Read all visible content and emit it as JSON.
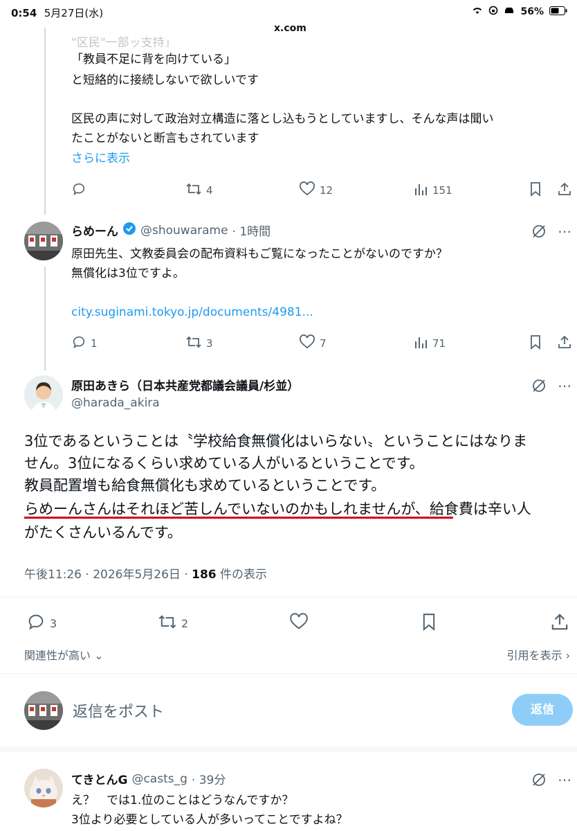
{
  "status_bar": {
    "time": "0:54",
    "date": "5月27日(水)",
    "battery": "56%",
    "url": "x.com"
  },
  "tweet_prev": {
    "partial_line1": "「教員不足に背を向けている」",
    "partial_line2": "と短絡的に接続しないで欲しいです",
    "partial_line3": "区民の声に対して政治対立構造に落とし込もうとしていますし、そんな声は聞い",
    "partial_line4": "たことがないと断言もされています",
    "show_more": "さらに表示",
    "retweets": "4",
    "likes": "12",
    "views": "151",
    "top_clip": "\"区民\"一部ッ支持」"
  },
  "tweet_rame": {
    "name": "らめーん",
    "handle": "@shouwarame",
    "time": "· 1時間",
    "line1": "原田先生、文教委員会の配布資料もご覧になったことがないのですか？",
    "line2": "無償化は3位ですよ。",
    "link": "city.suginami.tokyo.jp/documents/4981...",
    "replies": "1",
    "retweets": "3",
    "likes": "7",
    "views": "71"
  },
  "tweet_main": {
    "name": "原田あきら（日本共産党都議会議員/杉並）",
    "handle": "@harada_akira",
    "line1": "3位であるということは〝学校給食無償化はいらない〟ということにはなりま",
    "line2": "せん。3位になるくらい求めている人がいるということです。",
    "line3": "教員配置増も給食無償化も求めているということです。",
    "line4a": "らめーんさんはそれほど苦しんでいないのかもしれませんが、",
    "line4b": "給食費は辛い人",
    "line5": "がたくさんいるんです。",
    "meta_time": "午後11:26 · 2026年5月26日 · ",
    "meta_views": "186",
    "meta_views_label": " 件の表示",
    "replies": "3",
    "retweets": "2",
    "sort_label": "関連性が高い",
    "quotes_label": "引用を表示"
  },
  "compose": {
    "placeholder": "返信をポスト",
    "button": "返信"
  },
  "reply": {
    "name": "てきとんG",
    "handle": "@casts_g",
    "time": "· 39分",
    "line1": "え？　では1.位のことはどうなんですか？",
    "line2": "3位より必要としている人が多いってことですよね？"
  },
  "icons": {
    "reply": "reply-icon",
    "retweet": "retweet-icon",
    "like": "heart-icon",
    "views": "views-icon",
    "bookmark": "bookmark-icon",
    "share": "share-icon",
    "grok": "grok-icon",
    "more": "more-icon",
    "verified": "verified-badge-icon"
  },
  "colors": {
    "link": "#1d9bf0",
    "muted": "#536471",
    "underline": "#d0021b",
    "reply_button": "#8ecdf8"
  }
}
